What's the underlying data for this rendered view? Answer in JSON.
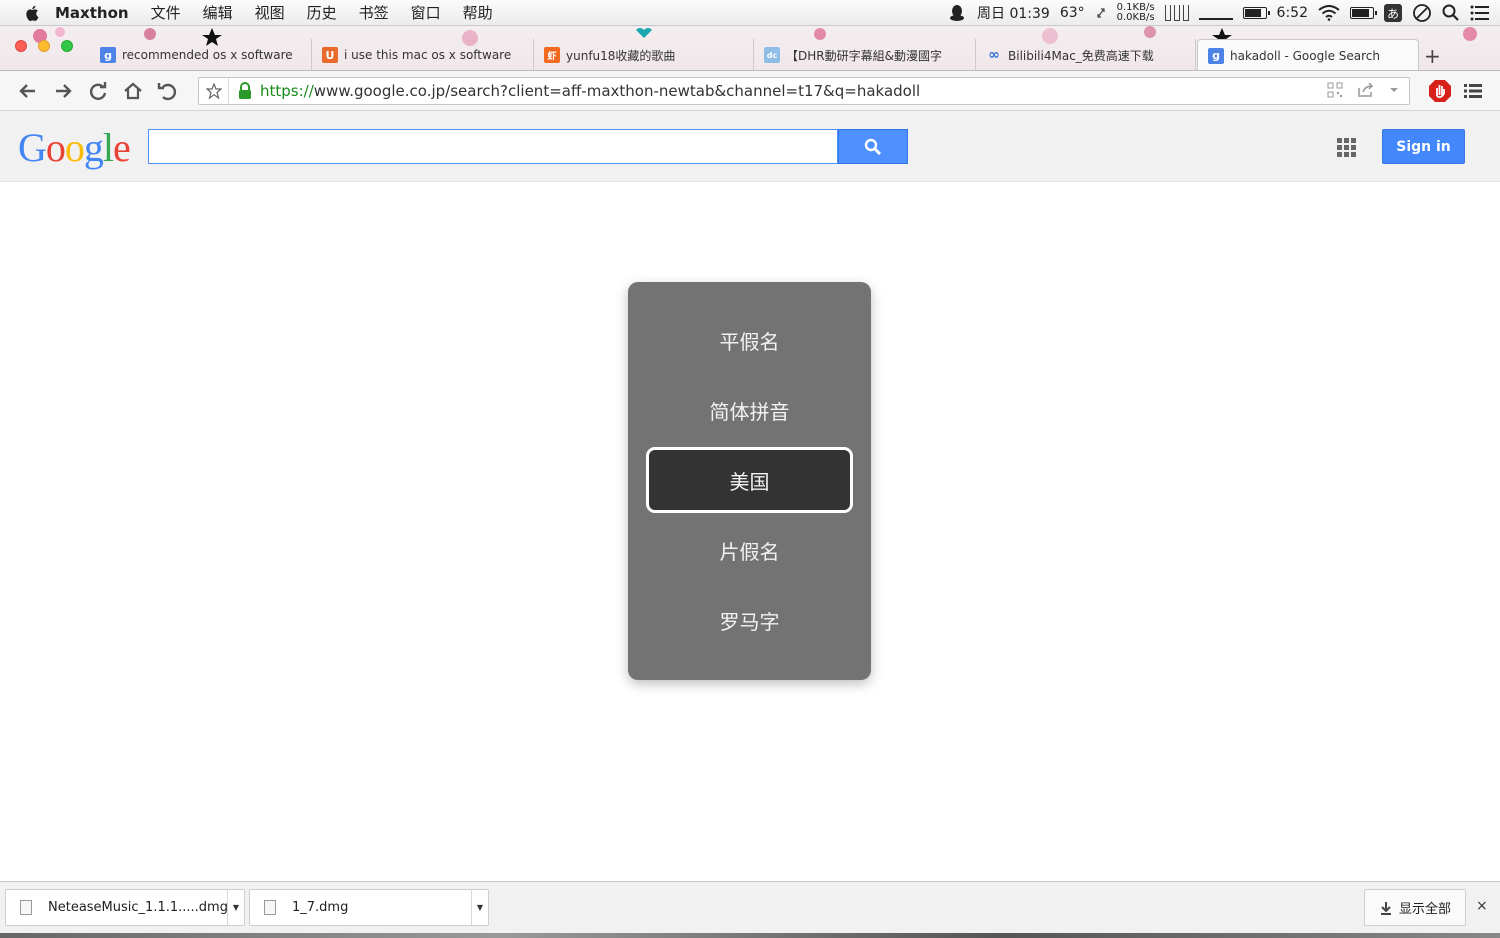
{
  "menubar": {
    "app_name": "Maxthon",
    "menus": [
      "文件",
      "编辑",
      "视图",
      "历史",
      "书签",
      "窗口",
      "帮助"
    ],
    "datetime": "周日 01:39",
    "temperature": "63°",
    "net_up": "0.1KB/s",
    "net_down": "0.0KB/s",
    "clock": "6:52",
    "ime_indicator": "あ"
  },
  "tabs": [
    {
      "title": "recommended os x software",
      "favicon": "g",
      "favicon_color": "#4d83e6"
    },
    {
      "title": "i use this mac os x software",
      "favicon": "U",
      "favicon_color": "#e86a2c"
    },
    {
      "title": "yunfu18收藏的歌曲",
      "favicon": "虾",
      "favicon_color": "#f26b21"
    },
    {
      "title": "【DHR動研字幕組&動漫國字",
      "favicon": "dc",
      "favicon_color": "#8fbde8"
    },
    {
      "title": "Bilibili4Mac_免费高速下载",
      "favicon": "∞",
      "favicon_color": "#2c6fd1"
    },
    {
      "title": "hakadoll - Google Search",
      "favicon": "g",
      "favicon_color": "#4d83e6"
    }
  ],
  "new_tab_label": "+",
  "address": {
    "url_secure": "https://",
    "url_rest": "www.google.co.jp/search?client=aff-maxthon-newtab&channel=t17&q=hakadoll"
  },
  "google": {
    "logo": "Google",
    "search_value": "",
    "signin_label": "Sign in"
  },
  "ime_popup": {
    "options": [
      "平假名",
      "简体拼音",
      "美国",
      "片假名",
      "罗马字"
    ],
    "selected_index": 2
  },
  "downloads": {
    "items": [
      "NeteaseMusic_1.1.1.....dmg",
      "1_7.dmg"
    ],
    "show_all_label": "显示全部",
    "close_label": "×"
  },
  "colors": {
    "accent_blue": "#4d90fe",
    "url_green": "#1a8a1a",
    "popup_gray": "#737373",
    "popup_selected": "#333333"
  }
}
